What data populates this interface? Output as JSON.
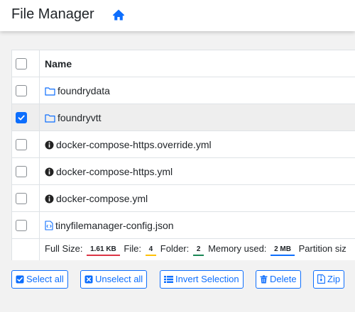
{
  "app": {
    "title": "File Manager",
    "home_icon": "home-icon",
    "accent_color": "#0d6efd"
  },
  "table": {
    "header": {
      "name_label": "Name"
    },
    "rows": [
      {
        "name": "foundrydata",
        "type": "folder",
        "icon": "folder-icon",
        "checked": false
      },
      {
        "name": "foundryvtt",
        "type": "folder",
        "icon": "folder-icon",
        "checked": true
      },
      {
        "name": "docker-compose-https.override.yml",
        "type": "file",
        "icon": "info-circle-icon",
        "checked": false
      },
      {
        "name": "docker-compose-https.yml",
        "type": "file",
        "icon": "info-circle-icon",
        "checked": false
      },
      {
        "name": "docker-compose.yml",
        "type": "file",
        "icon": "info-circle-icon",
        "checked": false
      },
      {
        "name": "tinyfilemanager-config.json",
        "type": "file",
        "icon": "code-file-icon",
        "checked": false
      }
    ]
  },
  "footer": {
    "full_size_label": "Full Size:",
    "full_size_value": "1.61 KB",
    "file_label": "File:",
    "file_value": "4",
    "folder_label": "Folder:",
    "folder_value": "2",
    "memory_label": "Memory used:",
    "memory_value": "2 MB",
    "partition_label": "Partition siz",
    "colors": {
      "full_size": "#dc3545",
      "file": "#ffc107",
      "folder": "#198754",
      "memory": "#0d6efd"
    }
  },
  "actions": {
    "select_all": "Select all",
    "unselect_all": "Unselect all",
    "invert_selection": "Invert Selection",
    "delete": "Delete",
    "zip": "Zip"
  }
}
